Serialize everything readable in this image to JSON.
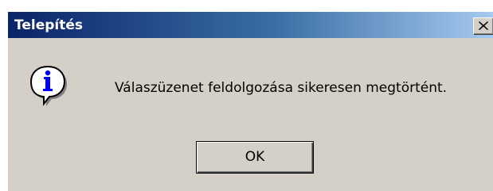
{
  "dialog": {
    "title": "Telepítés",
    "close_label": "×",
    "message": "Válaszüzenet feldolgozása sikeresen megtörtént.",
    "ok_label": "OK",
    "icon": "information-icon"
  },
  "colors": {
    "titlebar_start": "#0a246a",
    "titlebar_end": "#a6caf0",
    "face": "#d4d0c8",
    "icon_blue": "#0000ff"
  }
}
